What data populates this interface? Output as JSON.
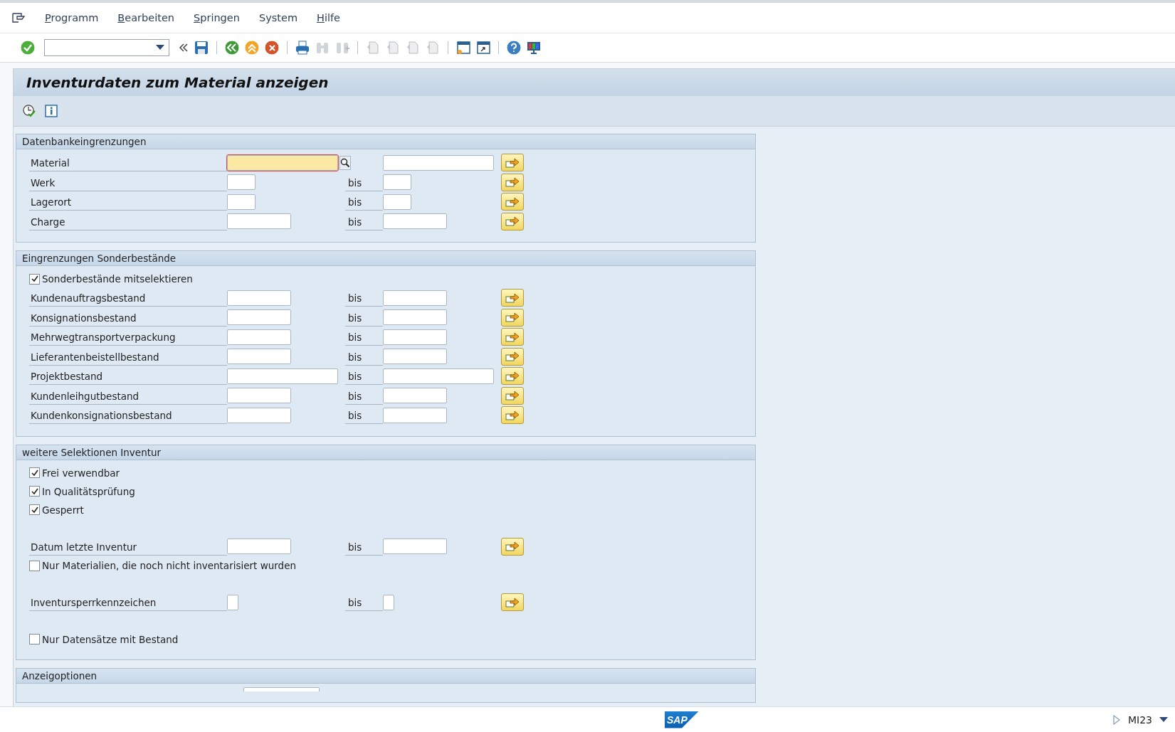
{
  "menu": [
    {
      "label": "Programm",
      "mnemonic": true
    },
    {
      "label": "Bearbeiten",
      "mnemonic": true
    },
    {
      "label": "Springen",
      "mnemonic": true
    },
    {
      "label": "System",
      "mnemonic": false
    },
    {
      "label": "Hilfe",
      "mnemonic": true
    }
  ],
  "title": "Inventurdaten zum Material anzeigen",
  "sections": [
    {
      "title": "Datenbankeingrenzungen",
      "rows": [
        {
          "kind": "range",
          "label": "Material",
          "from": {
            "kind": "long"
          },
          "to": {
            "kind": "long"
          },
          "focused": true,
          "search_help": true
        },
        {
          "kind": "range",
          "label": "Werk",
          "bis": "bis",
          "from": {
            "kind": "short"
          },
          "to": {
            "kind": "short"
          },
          "focused": false
        },
        {
          "kind": "range",
          "label": "Lagerort",
          "bis": "bis",
          "from": {
            "kind": "short"
          },
          "to": {
            "kind": "short"
          },
          "focused": false
        },
        {
          "kind": "range",
          "label": "Charge",
          "bis": "bis",
          "from": {
            "kind": "medium"
          },
          "to": {
            "kind": "medium"
          },
          "focused": false
        }
      ]
    },
    {
      "title": "Eingrenzungen Sonderbestände",
      "rows": [
        {
          "kind": "checkbox",
          "label": "Sonderbestände mitselektieren",
          "checked": true
        },
        {
          "kind": "range",
          "label": "Kundenauftragsbestand",
          "bis": "bis",
          "from": {
            "kind": "medium"
          },
          "to": {
            "kind": "medium"
          },
          "focused": false
        },
        {
          "kind": "range",
          "label": "Konsignationsbestand",
          "bis": "bis",
          "from": {
            "kind": "medium"
          },
          "to": {
            "kind": "medium"
          },
          "focused": false
        },
        {
          "kind": "range",
          "label": "Mehrwegtransportverpackung",
          "bis": "bis",
          "from": {
            "kind": "medium"
          },
          "to": {
            "kind": "medium"
          },
          "focused": false
        },
        {
          "kind": "range",
          "label": "Lieferantenbeistellbestand",
          "bis": "bis",
          "from": {
            "kind": "medium"
          },
          "to": {
            "kind": "medium"
          },
          "focused": false
        },
        {
          "kind": "range",
          "label": "Projektbestand",
          "bis": "bis",
          "from": {
            "kind": "long"
          },
          "to": {
            "kind": "long"
          },
          "focused": false
        },
        {
          "kind": "range",
          "label": "Kundenleihgutbestand",
          "bis": "bis",
          "from": {
            "kind": "medium"
          },
          "to": {
            "kind": "medium"
          },
          "focused": false
        },
        {
          "kind": "range",
          "label": "Kundenkonsignationsbestand",
          "bis": "bis",
          "from": {
            "kind": "medium"
          },
          "to": {
            "kind": "medium"
          },
          "focused": false
        }
      ]
    },
    {
      "title": "weitere Selektionen Inventur",
      "rows": [
        {
          "kind": "checkbox",
          "label": "Frei verwendbar",
          "checked": true
        },
        {
          "kind": "checkbox",
          "label": "In Qualitätsprüfung",
          "checked": true
        },
        {
          "kind": "checkbox",
          "label": "Gesperrt",
          "checked": true
        },
        {
          "kind": "spacer"
        },
        {
          "kind": "range",
          "label": "Datum letzte Inventur",
          "bis": "bis",
          "from": {
            "kind": "medium"
          },
          "to": {
            "kind": "medium"
          },
          "focused": false
        },
        {
          "kind": "checkbox",
          "label": "Nur Materialien, die noch nicht inventarisiert wurden",
          "checked": false
        },
        {
          "kind": "spacer"
        },
        {
          "kind": "range",
          "label": "Inventursperrkennzeichen",
          "bis": "bis",
          "from": {
            "kind": "tiny"
          },
          "to": {
            "kind": "tiny"
          },
          "focused": false
        },
        {
          "kind": "spacer"
        },
        {
          "kind": "checkbox",
          "label": "Nur Datensätze mit Bestand",
          "checked": false
        }
      ]
    },
    {
      "title": "Anzeigoptionen",
      "rows": [
        {
          "kind": "partial_field"
        }
      ]
    }
  ],
  "status": {
    "logo": "SAP",
    "transaction": "MI23"
  }
}
